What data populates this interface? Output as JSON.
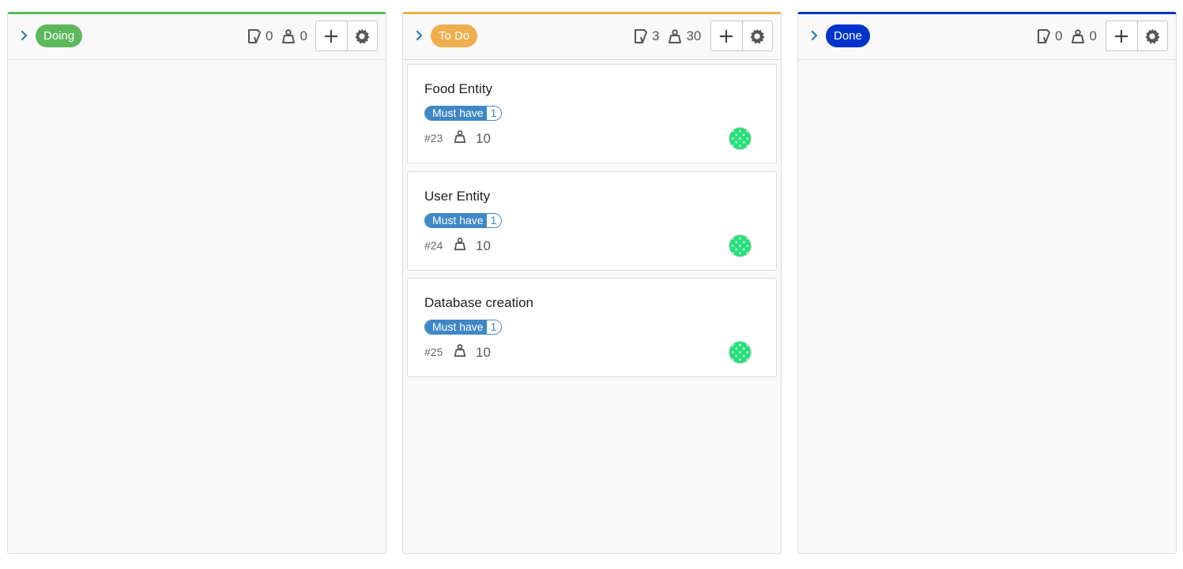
{
  "colors": {
    "doing": "#5cb85c",
    "todo": "#f0ad4e",
    "done": "#0033cc",
    "tag": "#3f87c5",
    "icon": "#555555"
  },
  "columns": [
    {
      "key": "doing",
      "label": "Doing",
      "card_count": "0",
      "weight_total": "0",
      "icons": [
        "chevron-right-icon",
        "card-icon",
        "weight-icon",
        "plus-icon",
        "gear-icon"
      ],
      "cards": []
    },
    {
      "key": "todo",
      "label": "To Do",
      "card_count": "3",
      "weight_total": "30",
      "cards": [
        {
          "title": "Food Entity",
          "tag": "Must have",
          "tag_count": "1",
          "number": "#23",
          "weight": "10"
        },
        {
          "title": "User Entity",
          "tag": "Must have",
          "tag_count": "1",
          "number": "#24",
          "weight": "10"
        },
        {
          "title": "Database creation",
          "tag": "Must have",
          "tag_count": "1",
          "number": "#25",
          "weight": "10"
        }
      ]
    },
    {
      "key": "done",
      "label": "Done",
      "card_count": "0",
      "weight_total": "0",
      "cards": []
    }
  ]
}
